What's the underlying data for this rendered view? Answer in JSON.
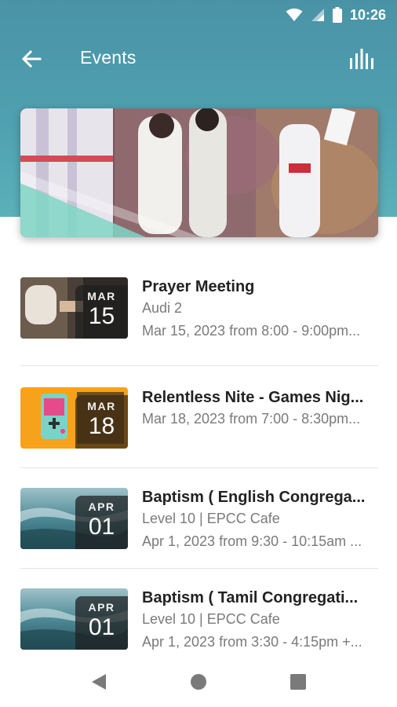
{
  "status_bar": {
    "time": "10:26",
    "icons": [
      "wifi-icon",
      "signal-icon",
      "battery-icon"
    ]
  },
  "app_bar": {
    "title": "Events",
    "back_icon": "arrow-left-icon",
    "action_icon": "bar-chart-icon"
  },
  "colors": {
    "header": "#4fa0b0",
    "title_text": "#222222",
    "secondary_text": "#7a7a7a"
  },
  "events": [
    {
      "month": "MAR",
      "day": "15",
      "name": "Prayer Meeting",
      "lines": [
        "Audi 2",
        "Mar 15, 2023 from 8:00 - 9:00pm..."
      ]
    },
    {
      "month": "MAR",
      "day": "18",
      "name": "Relentless Nite - Games Nig...",
      "lines": [
        "Mar 18, 2023 from 7:00 - 8:30pm..."
      ]
    },
    {
      "month": "APR",
      "day": "01",
      "name": "Baptism ( English Congrega...",
      "lines": [
        "Level 10 | EPCC Cafe",
        "Apr 1, 2023 from 9:30 - 10:15am ..."
      ]
    },
    {
      "month": "APR",
      "day": "01",
      "name": "Baptism ( Tamil Congregati...",
      "lines": [
        "Level 10 | EPCC Cafe",
        "Apr 1, 2023 from 3:30 - 4:15pm +..."
      ]
    }
  ],
  "nav_bar": {
    "icons": [
      "back-triangle-icon",
      "home-circle-icon",
      "recents-square-icon"
    ]
  }
}
